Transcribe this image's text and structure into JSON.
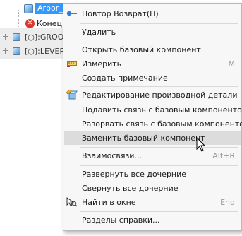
{
  "tree": {
    "selected_item": "Arbor_",
    "end_item": "Конец д",
    "items": [
      {
        "label": "[○]:GROOV"
      },
      {
        "label": "[○]:LEVER"
      }
    ]
  },
  "menu": {
    "items": [
      {
        "label": "Повтор Возврат(П)",
        "shortcut": "",
        "icon": "return-arrow-icon",
        "highlighted": false
      },
      {
        "label": "Удалить",
        "shortcut": "",
        "icon": "",
        "highlighted": false
      },
      {
        "label": "Открыть базовый компонент",
        "shortcut": "",
        "icon": "",
        "highlighted": false
      },
      {
        "label": "Измерить",
        "shortcut": "M",
        "icon": "ruler-icon",
        "highlighted": false
      },
      {
        "label": "Создать примечание",
        "shortcut": "",
        "icon": "",
        "highlighted": false
      },
      {
        "label": "Редактирование производной детали",
        "shortcut": "",
        "icon": "derived-part-edit-icon",
        "highlighted": false
      },
      {
        "label": "Подавить связь с базовым компонентом",
        "shortcut": "",
        "icon": "",
        "highlighted": false
      },
      {
        "label": "Разорвать связь с базовым компонентом",
        "shortcut": "",
        "icon": "",
        "highlighted": false
      },
      {
        "label": "Заменить базовый компонент",
        "shortcut": "",
        "icon": "",
        "highlighted": true
      },
      {
        "label": "Взаимосвязи...",
        "shortcut": "Alt+R",
        "icon": "",
        "highlighted": false
      },
      {
        "label": "Развернуть все дочерние",
        "shortcut": "",
        "icon": "",
        "highlighted": false
      },
      {
        "label": "Свернуть все дочерние",
        "shortcut": "",
        "icon": "",
        "highlighted": false
      },
      {
        "label": "Найти в окне",
        "shortcut": "End",
        "icon": "find-in-window-icon",
        "highlighted": false
      },
      {
        "label": "Разделы справки...",
        "shortcut": "",
        "icon": "",
        "highlighted": false
      }
    ]
  },
  "colors": {
    "selection": "#3399ff",
    "menu_highlight": "#dcdcdc",
    "menu_background": "#f7f7f7",
    "shortcut_text": "#9a9a9a"
  }
}
